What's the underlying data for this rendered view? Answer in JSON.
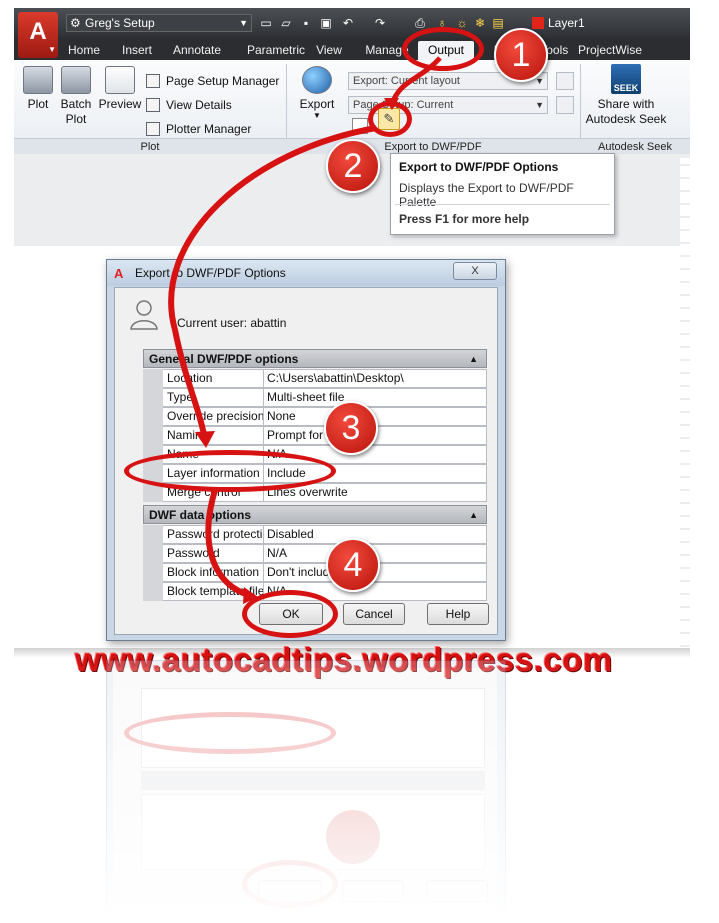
{
  "app": {
    "logo_letter": "A",
    "workspace": "Greg's Setup",
    "layer_name": "Layer1",
    "accent_color": "#d71212"
  },
  "qat_icons": [
    "new-icon",
    "open-icon",
    "save-icon",
    "saveas-icon",
    "undo-icon",
    "redo-icon",
    "plot-icon",
    "bulb-icon",
    "sun-icon",
    "lock-icon",
    "color-icon"
  ],
  "ribbon": {
    "tabs": [
      "Home",
      "Insert",
      "Annotate",
      "Parametric",
      "View",
      "Manage",
      "Output",
      "Express Tools",
      "ProjectWise"
    ],
    "active_tab": "Output",
    "plot_panel": {
      "title": "Plot",
      "plot": "Plot",
      "batch_plot": "Batch Plot",
      "preview": "Preview",
      "page_setup_manager": "Page Setup Manager",
      "view_details": "View Details",
      "plotter_manager": "Plotter Manager"
    },
    "export_panel": {
      "title": "Export to DWF/PDF",
      "export": "Export",
      "export_combo": "Export: Current layout",
      "page_setup_combo": "Page Setup: Current"
    },
    "seek_panel": {
      "title": "Autodesk Seek",
      "share": "Share with Autodesk Seek",
      "seek_icon_text": "SEEK"
    }
  },
  "tooltip": {
    "title": "Export to DWF/PDF Options",
    "description": "Displays the Export to DWF/PDF Palette",
    "help": "Press F1 for more help"
  },
  "dialog": {
    "title": "Export to DWF/PDF Options",
    "close": "X",
    "user_label": "Current user: abattin",
    "general_section": "General DWF/PDF options",
    "general_rows": [
      {
        "name": "Location",
        "value": "C:\\Users\\abattin\\Desktop\\"
      },
      {
        "name": "Type",
        "value": "Multi-sheet file"
      },
      {
        "name": "Override precision",
        "value": "None"
      },
      {
        "name": "Naming",
        "value": "Prompt for name"
      },
      {
        "name": "Name",
        "value": "N/A"
      },
      {
        "name": "Layer information",
        "value": "Include"
      },
      {
        "name": "Merge control",
        "value": "Lines overwrite"
      }
    ],
    "dwf_section": "DWF data options",
    "dwf_rows": [
      {
        "name": "Password protection",
        "value": "Disabled"
      },
      {
        "name": "Password",
        "value": "N/A"
      },
      {
        "name": "Block information",
        "value": "Don't include"
      },
      {
        "name": "Block template file",
        "value": "N/A"
      }
    ],
    "ok": "OK",
    "cancel": "Cancel",
    "help": "Help"
  },
  "annotations": {
    "steps": [
      "1",
      "2",
      "3",
      "4"
    ],
    "watermark": "www.autocadtips.wordpress.com"
  }
}
